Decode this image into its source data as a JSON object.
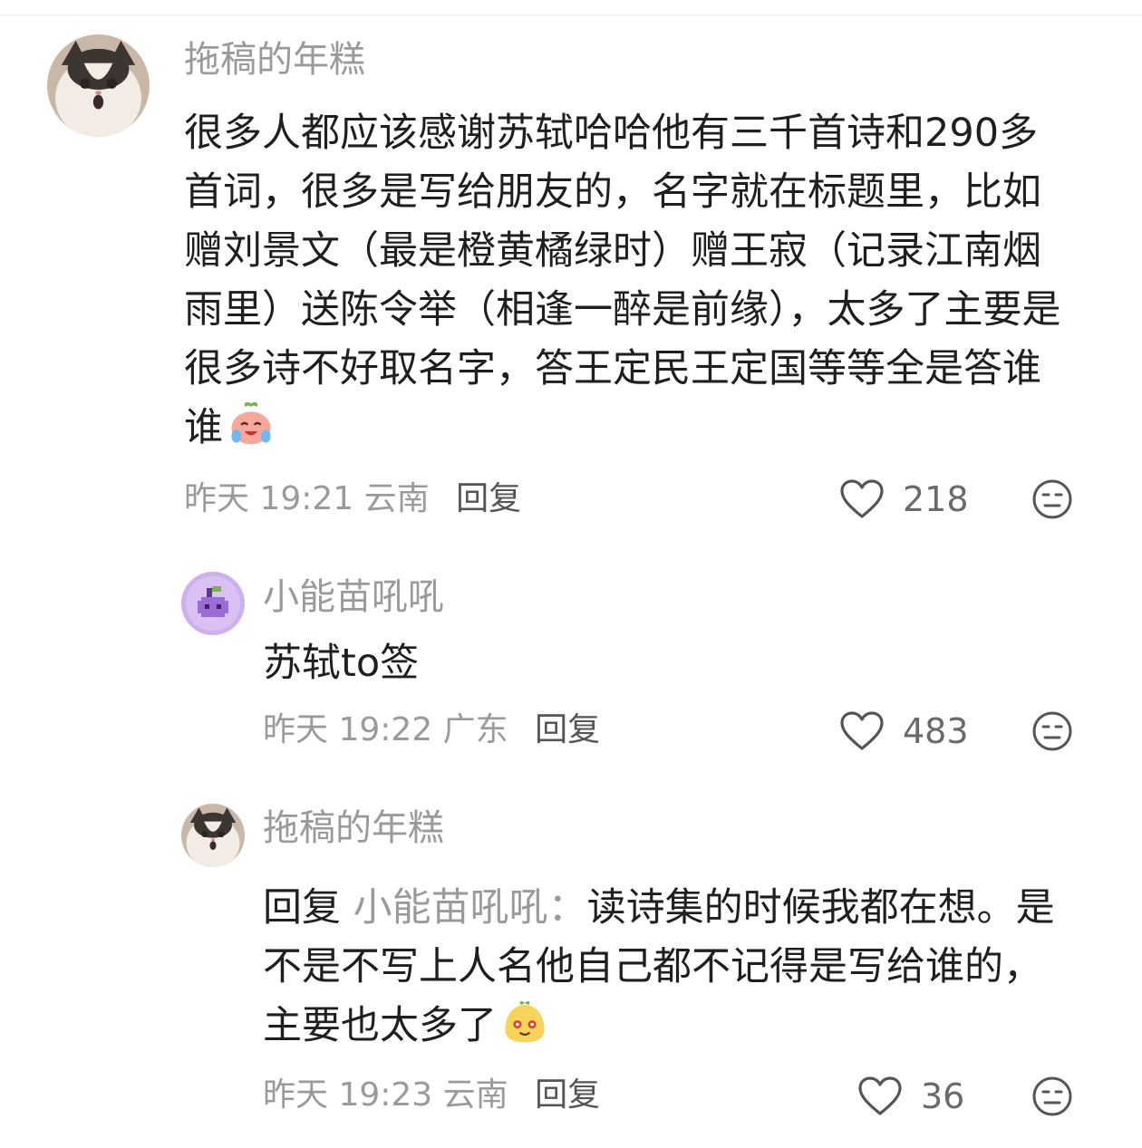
{
  "comments": [
    {
      "avatar_icon": "cat-avatar-icon",
      "username": "拖稿的年糕",
      "text": "很多人都应该感谢苏轼哈哈他有三千首诗和290多首词，很多是写给朋友的，名字就在标题里，比如赠刘景文（最是橙黄橘绿时）赠王寂（记录江南烟雨里）送陈令举（相逢一醉是前缘），太多了主要是很多诗不好取名字，答王定民王定国等等全是答谁谁",
      "emoji": "crying-laugh-emoji",
      "time": "昨天 19:21",
      "location": "云南",
      "reply_label": "回复",
      "likes": "218"
    },
    {
      "avatar_icon": "purple-pixel-avatar-icon",
      "username": "小能苗吼吼",
      "text": "苏轼to签",
      "time": "昨天 19:22",
      "location": "广东",
      "reply_label": "回复",
      "likes": "483"
    },
    {
      "avatar_icon": "cat-avatar-icon",
      "username": "拖稿的年糕",
      "reply_prefix": "回复",
      "reply_to": "小能苗吼吼：",
      "text": "读诗集的时候我都在想。是不是不写上人名他自己都不记得是写给谁的，主要也太多了",
      "emoji": "smiling-bun-emoji",
      "time": "昨天 19:23",
      "location": "云南",
      "reply_label": "回复",
      "likes": "36"
    }
  ],
  "colors": {
    "muted": "#9a9a9a",
    "text": "#1f1f1f",
    "avatar_purple": "#b48ae0"
  }
}
